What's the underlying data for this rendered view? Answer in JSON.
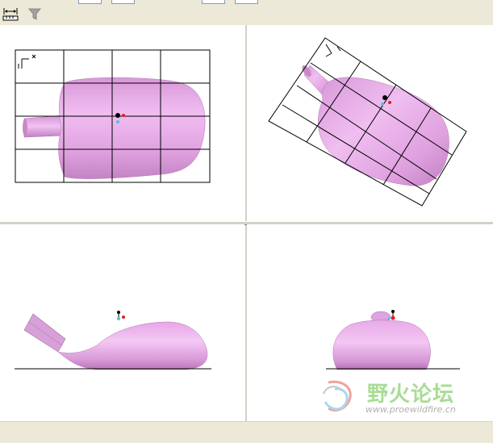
{
  "colors": {
    "background": "#ece9d8",
    "viewport": "#ffffff",
    "model": "#e6a6e6",
    "grid": "#000000",
    "watermark_text": "#9fd98a",
    "axis_red": "#e02020",
    "axis_cyan": "#40c8e0"
  },
  "toolbar": {
    "fields": [
      "",
      "",
      "",
      ""
    ],
    "icons": [
      "fit-width-icon",
      "filter-icon"
    ]
  },
  "viewports": [
    {
      "name": "top-view"
    },
    {
      "name": "rotated-view"
    },
    {
      "name": "front-view"
    },
    {
      "name": "side-view"
    }
  ],
  "watermark": {
    "title": "野火论坛",
    "url": "www.proewildfire.cn"
  }
}
